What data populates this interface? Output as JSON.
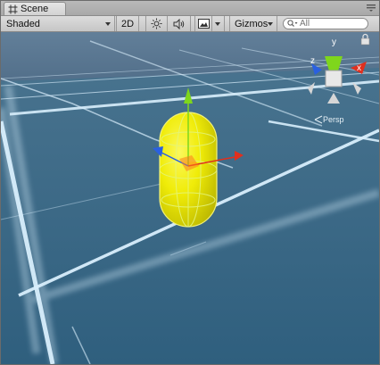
{
  "window": {
    "tab_label": "Scene"
  },
  "toolbar": {
    "draw_mode": "Shaded",
    "mode_2d": "2D",
    "gizmos_label": "Gizmos",
    "search_placeholder": "All"
  },
  "icons": {
    "tab": "grid-icon",
    "lighting": "sun-icon",
    "audio": "speaker-icon",
    "effects": "image-icon",
    "search": "magnifier-icon",
    "window_menu": "menu-icon",
    "lock": "lock-icon"
  },
  "orientation_gizmo": {
    "y_label": "y",
    "x_label": "x",
    "z_label": "z",
    "projection": "Persp"
  },
  "colors": {
    "sky": "#5a7c99",
    "ground": "#3d6a86",
    "grid_line": "#e8f4ff",
    "capsule": "#f2ee05",
    "axis_x": "#e0301e",
    "axis_y": "#7fd61c",
    "axis_z": "#2a60e0"
  }
}
